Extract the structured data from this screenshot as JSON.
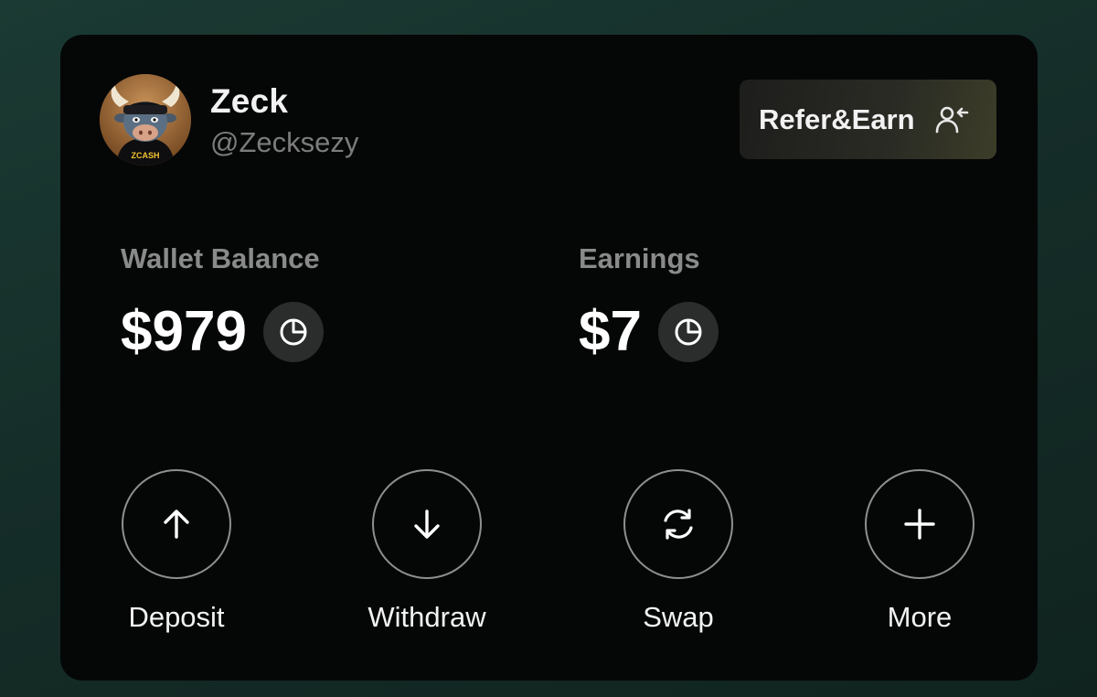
{
  "profile": {
    "name": "Zeck",
    "handle": "@Zecksezy",
    "avatar_text": "ZCASH"
  },
  "refer": {
    "label": "Refer&Earn",
    "icon": "user-add-icon"
  },
  "stats": {
    "wallet": {
      "label": "Wallet Balance",
      "value": "$979",
      "icon": "pie-chart-icon"
    },
    "earnings": {
      "label": "Earnings",
      "value": "$7",
      "icon": "pie-chart-icon"
    }
  },
  "actions": [
    {
      "label": "Deposit",
      "icon": "arrow-up-icon"
    },
    {
      "label": "Withdraw",
      "icon": "arrow-down-icon"
    },
    {
      "label": "Swap",
      "icon": "swap-icon"
    },
    {
      "label": "More",
      "icon": "plus-icon"
    }
  ],
  "colors": {
    "background": "#17322c",
    "card": "#050707",
    "text": "#f2f2f2",
    "muted": "#8a8a8a",
    "icon_bg": "#2b2d2d"
  }
}
